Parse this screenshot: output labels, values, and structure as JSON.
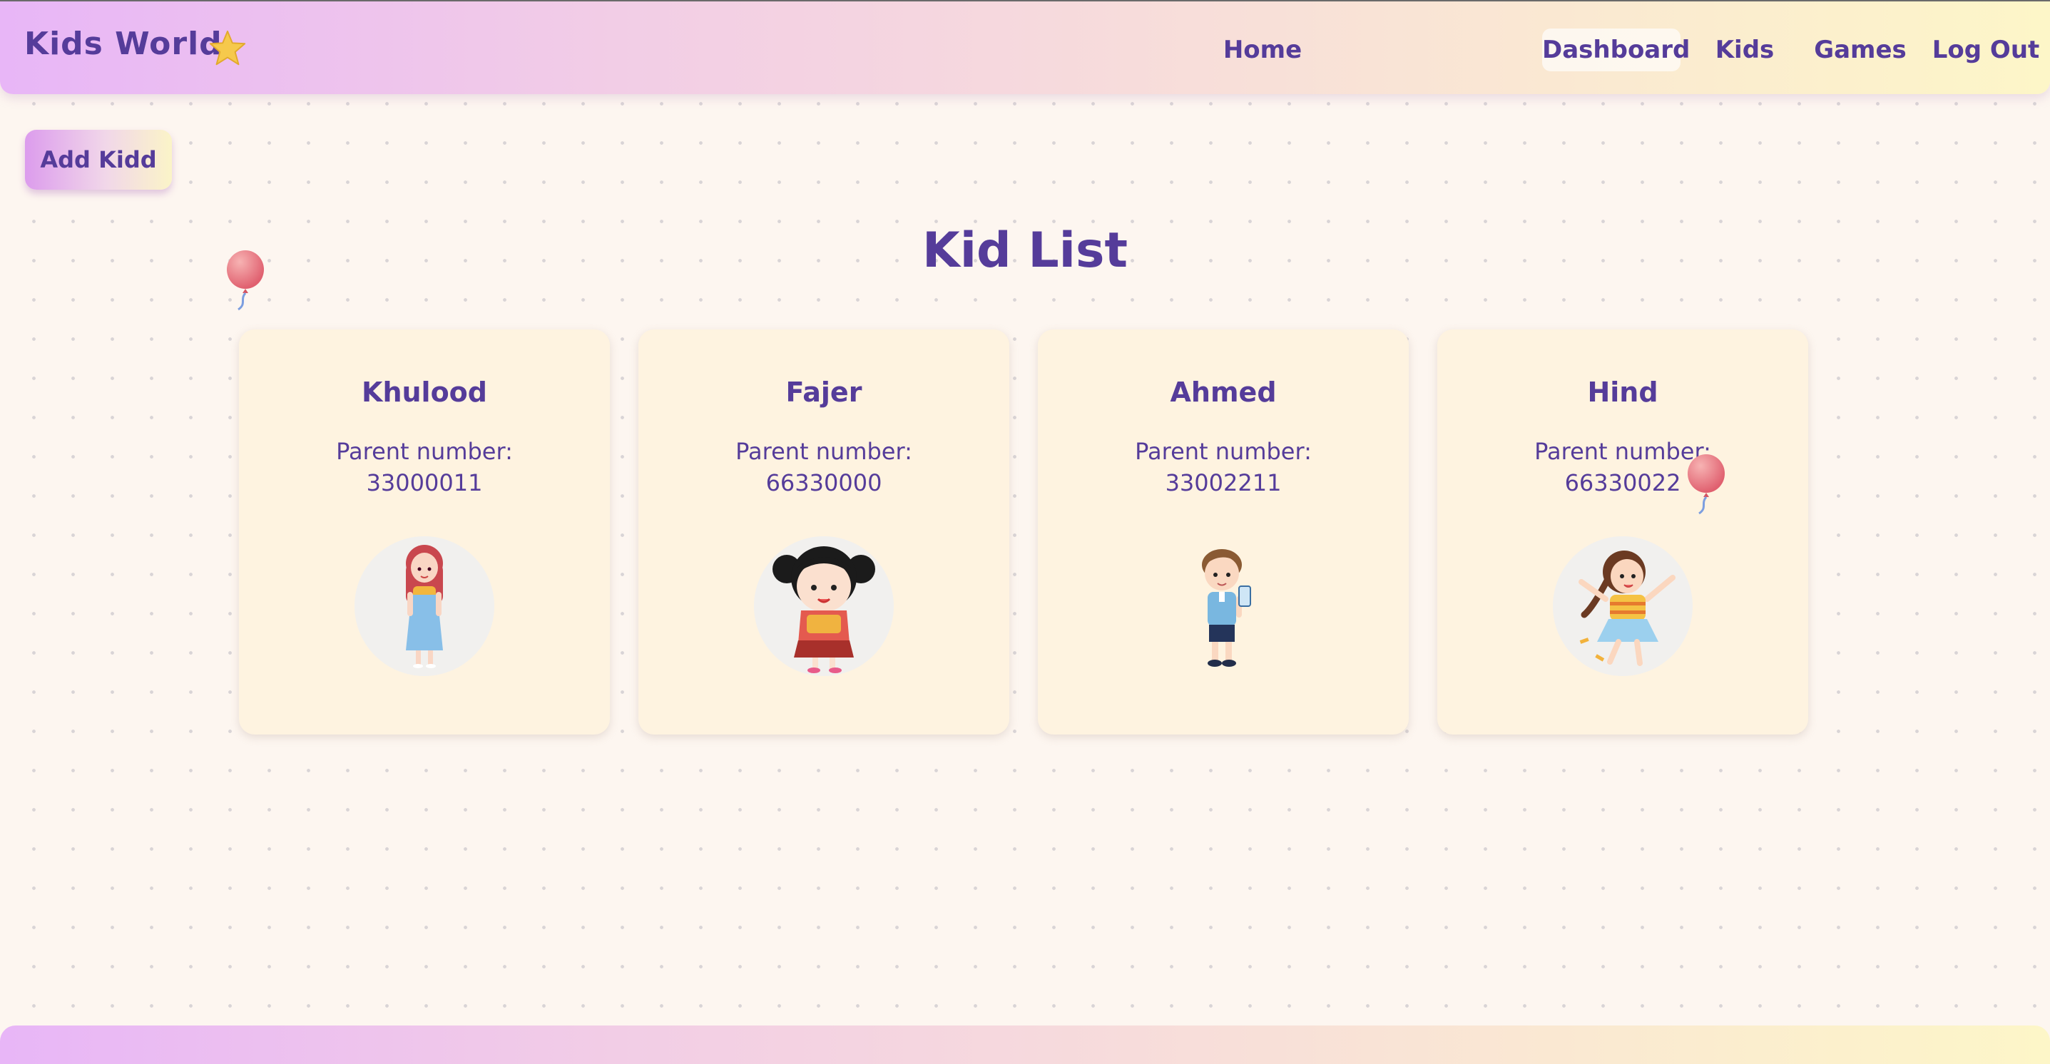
{
  "header": {
    "brand": "Kids World",
    "nav": [
      {
        "label": "Home",
        "active": false
      },
      {
        "label": "Dashboard",
        "active": true
      },
      {
        "label": "Kids",
        "active": false
      },
      {
        "label": "Games",
        "active": false
      },
      {
        "label": "Log Out",
        "active": false
      }
    ]
  },
  "actions": {
    "add_label": "Add Kidd"
  },
  "page": {
    "title": "Kid List"
  },
  "kids": [
    {
      "name": "Khulood",
      "parent_label": "Parent number:",
      "parent_number": "33000011",
      "avatar": "girl-blue-dress-icon"
    },
    {
      "name": "Fajer",
      "parent_label": "Parent number:",
      "parent_number": "66330000",
      "avatar": "girl-pigtails-icon"
    },
    {
      "name": "Ahmed",
      "parent_label": "Parent number:",
      "parent_number": "33002211",
      "avatar": "boy-phone-icon"
    },
    {
      "name": "Hind",
      "parent_label": "Parent number:",
      "parent_number": "66330022",
      "avatar": "girl-jumping-icon"
    }
  ],
  "colors": {
    "primary_text": "#553c9a",
    "page_bg": "#fdf6f0",
    "card_bg": "#fef3e0",
    "gradient_start": "#e8b6f7",
    "gradient_end": "#fdf6c8",
    "balloon": "#e87a86"
  }
}
